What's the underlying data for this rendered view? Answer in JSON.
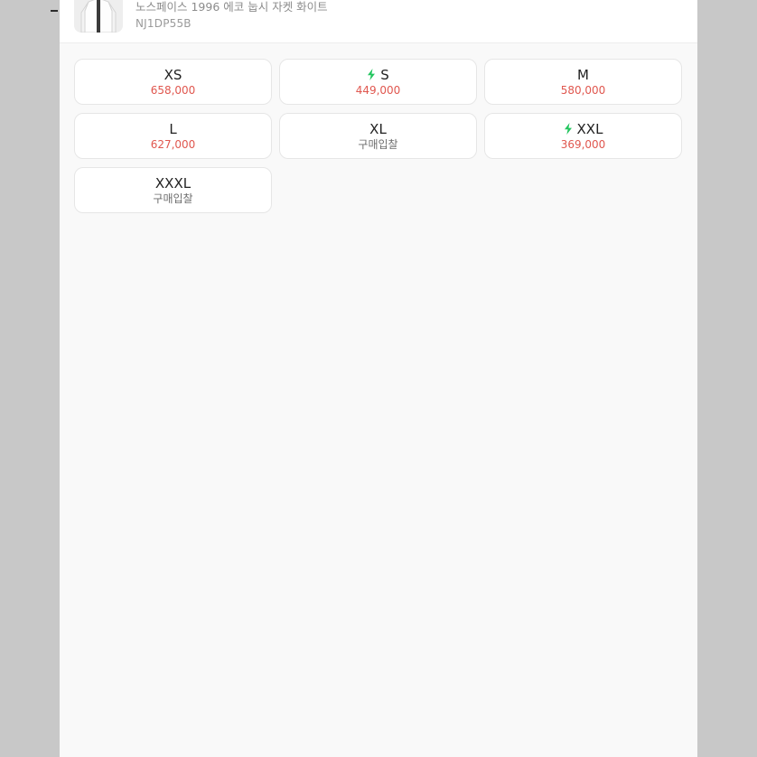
{
  "product": {
    "name": "노스페이스 1996 에코 눕시 자켓 화이트",
    "code": "NJ1DP55B"
  },
  "colors": {
    "price": "#e0574f",
    "bid": "#6e6e6e",
    "bolt": "#22c55e"
  },
  "sizes": [
    {
      "label": "XS",
      "price": "658,000",
      "fast": false,
      "kind": "price"
    },
    {
      "label": "S",
      "price": "449,000",
      "fast": true,
      "kind": "price"
    },
    {
      "label": "M",
      "price": "580,000",
      "fast": false,
      "kind": "price"
    },
    {
      "label": "L",
      "price": "627,000",
      "fast": false,
      "kind": "price"
    },
    {
      "label": "XL",
      "price": "구매입찰",
      "fast": false,
      "kind": "bid"
    },
    {
      "label": "XXL",
      "price": "369,000",
      "fast": true,
      "kind": "price"
    },
    {
      "label": "XXXL",
      "price": "구매입찰",
      "fast": false,
      "kind": "bid"
    }
  ]
}
